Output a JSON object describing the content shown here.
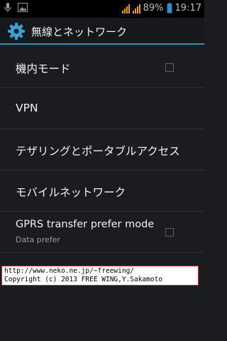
{
  "status_bar": {
    "battery": "89%",
    "time": "19:17",
    "icons": [
      "mic-icon",
      "image-icon",
      "signal-icon",
      "battery-icon"
    ],
    "accent": "#f29a1f"
  },
  "action_bar": {
    "title": "無線とネットワーク",
    "icon": "settings-gear-icon",
    "accent": "#2f8fbf"
  },
  "settings": [
    {
      "label": "機内モード",
      "checkbox": true
    },
    {
      "label": "VPN"
    },
    {
      "label": "テザリングとポータブルアクセス"
    },
    {
      "label": "モバイルネットワーク"
    },
    {
      "label": "GPRS transfer prefer mode",
      "summary": "Data prefer",
      "checkbox": true
    }
  ],
  "watermark": {
    "line1": "http://www.neko.ne.jp/~freewing/",
    "line2": "Copyright (c) 2013 FREE WING,Y.Sakamoto"
  }
}
